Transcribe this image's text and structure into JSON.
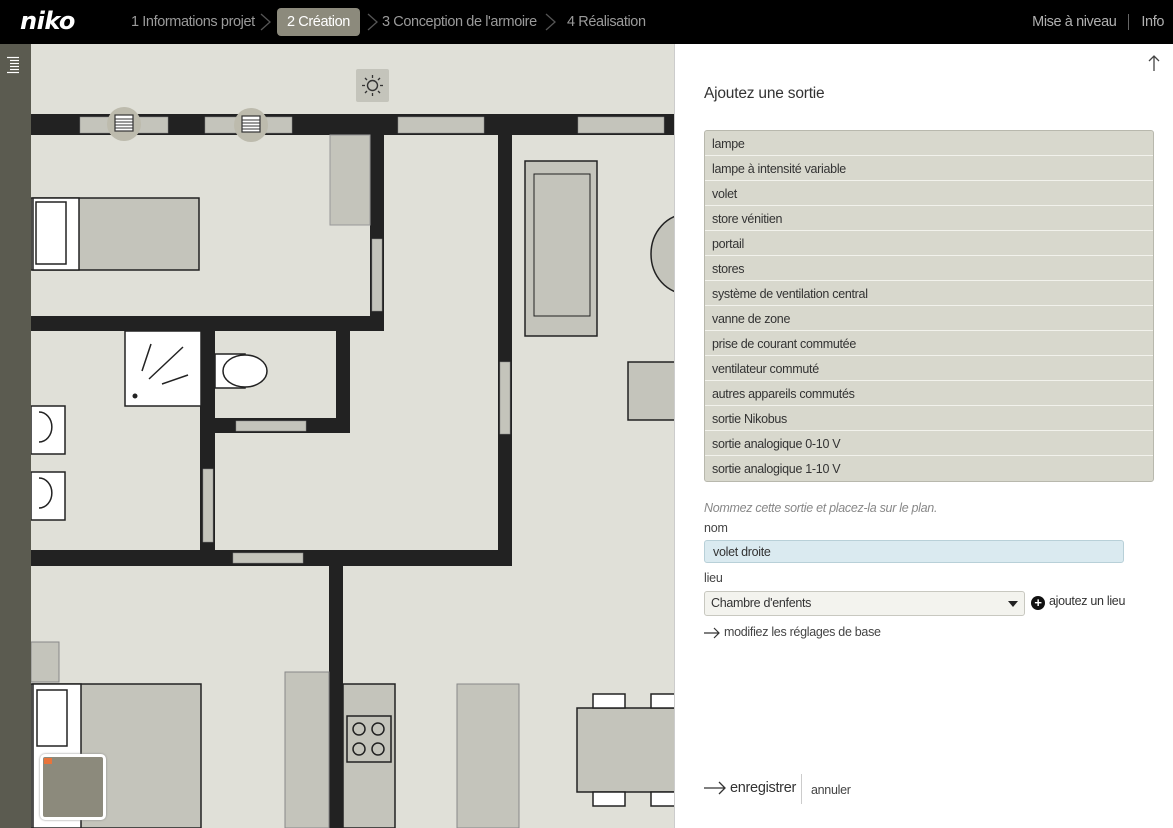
{
  "app": {
    "logo": "niko"
  },
  "steps": [
    {
      "label": "1 Informations projet",
      "active": false
    },
    {
      "label": "2 Création",
      "active": true
    },
    {
      "label": "3 Conception de l'armoire",
      "active": false
    },
    {
      "label": "4 Réalisation",
      "active": false
    }
  ],
  "top_right": {
    "upgrade": "Mise à niveau",
    "info": "Info"
  },
  "panel": {
    "title": "Ajoutez une sortie",
    "outputs": [
      "lampe",
      "lampe à intensité variable",
      "volet",
      "store vénitien",
      "portail",
      "stores",
      "système de ventilation central",
      "vanne de zone",
      "prise de courant commutée",
      "ventilateur commuté",
      "autres appareils commutés",
      "sortie Nikobus",
      "sortie analogique 0-10 V",
      "sortie analogique 1-10 V"
    ],
    "hint": "Nommez cette sortie et placez-la sur le plan.",
    "name_label": "nom",
    "name_value": "volet droite",
    "place_label": "lieu",
    "place_value": "Chambre d'enfents",
    "add_place": "ajoutez un lieu",
    "base_settings": "modifiez les réglages de base",
    "save": "enregistrer",
    "cancel": "annuler"
  },
  "colors": {
    "accent": "#8c8a7c",
    "sidebar": "#5b5b50",
    "plan_bg": "#e0e0d8",
    "wall": "#222222",
    "list_bg": "#d8d8cd",
    "input_bg": "#daeaf0"
  },
  "icons": [
    "menu-icon",
    "sun-icon",
    "shutter-icon",
    "up-arrow-icon",
    "plus-icon",
    "arrow-right-icon",
    "chevron-right-icon",
    "caret-down-icon"
  ]
}
